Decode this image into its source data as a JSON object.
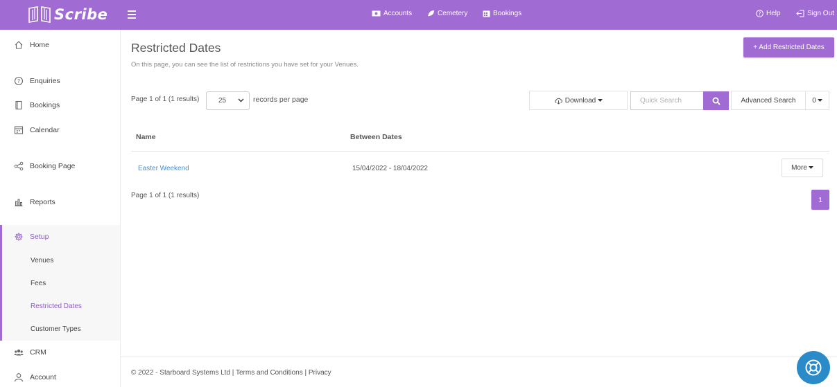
{
  "app": {
    "logo_text": "Scribe"
  },
  "topnav": {
    "accounts": "Accounts",
    "cemetery": "Cemetery",
    "bookings": "Bookings",
    "help": "Help",
    "signout": "Sign Out"
  },
  "sidebar": {
    "home": "Home",
    "enquiries": "Enquiries",
    "bookings": "Bookings",
    "calendar": "Calendar",
    "booking_page": "Booking Page",
    "reports": "Reports",
    "setup": "Setup",
    "sub": {
      "venues": "Venues",
      "fees": "Fees",
      "restricted_dates": "Restricted Dates",
      "customer_types": "Customer Types"
    },
    "crm": "CRM",
    "account": "Account"
  },
  "page": {
    "title": "Restricted Dates",
    "description": "On this page, you can see the list of restrictions you have set for your Venues.",
    "add_button": "+ Add Restricted Dates"
  },
  "toolbar": {
    "pager_top": "Page 1 of 1 (1 results)",
    "per_page_value": "25",
    "records_label": "records per page",
    "download": "Download",
    "search_placeholder": "Quick Search",
    "advanced_search": "Advanced Search",
    "filter_count": "0"
  },
  "table": {
    "headers": [
      "Name",
      "Between Dates"
    ],
    "rows": [
      {
        "name": "Easter Weekend",
        "dates": "15/04/2022 - 18/04/2022",
        "action": "More"
      }
    ]
  },
  "pager_bottom": "Page 1 of 1 (1 results)",
  "pagination": {
    "current": "1"
  },
  "footer": {
    "copyright": "© 2022 - Starboard Systems Ltd |",
    "terms": "Terms and Conditions",
    "sep": "|",
    "privacy": "Privacy"
  },
  "colors": {
    "brand": "#a06bd2",
    "link": "#4a8fd4",
    "fab": "#2a8bc8"
  }
}
